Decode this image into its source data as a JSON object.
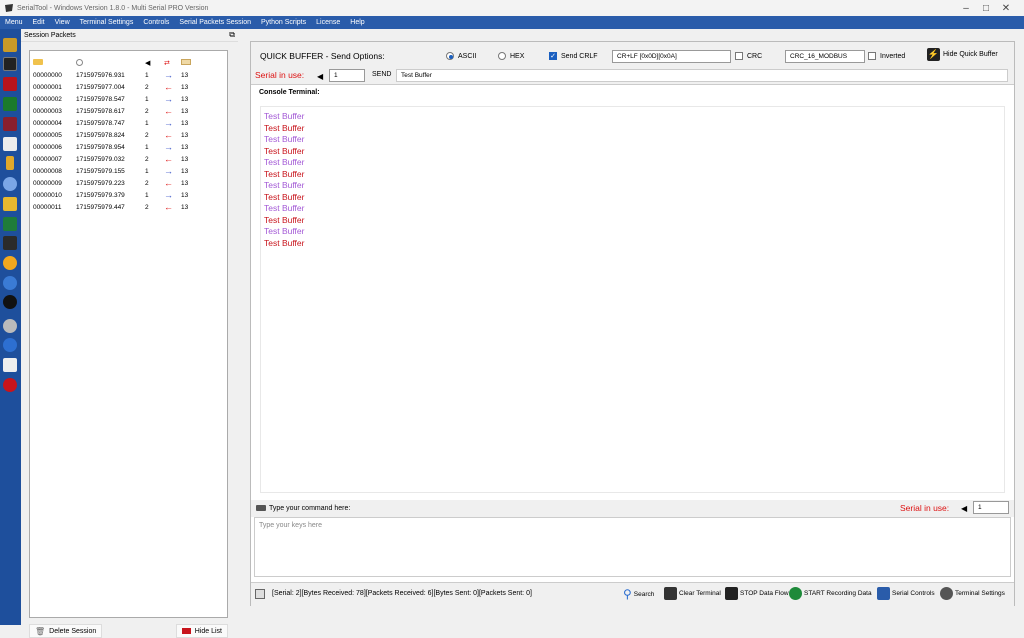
{
  "window": {
    "title": "SerialTool - Windows Version 1.8.0 - Multi Serial PRO Version"
  },
  "menu": [
    "Menu",
    "Edit",
    "View",
    "Terminal Settings",
    "Controls",
    "Serial Packets Session",
    "Python Scripts",
    "License",
    "Help"
  ],
  "sidebar": {
    "title": "Session Packets"
  },
  "packets": [
    {
      "id": "00000000",
      "ts": "1715975976.931",
      "port": "1",
      "dir": "out",
      "len": "13"
    },
    {
      "id": "00000001",
      "ts": "1715975977.004",
      "port": "2",
      "dir": "in",
      "len": "13"
    },
    {
      "id": "00000002",
      "ts": "1715975978.547",
      "port": "1",
      "dir": "out",
      "len": "13"
    },
    {
      "id": "00000003",
      "ts": "1715975978.617",
      "port": "2",
      "dir": "in",
      "len": "13"
    },
    {
      "id": "00000004",
      "ts": "1715975978.747",
      "port": "1",
      "dir": "out",
      "len": "13"
    },
    {
      "id": "00000005",
      "ts": "1715975978.824",
      "port": "2",
      "dir": "in",
      "len": "13"
    },
    {
      "id": "00000006",
      "ts": "1715975978.954",
      "port": "1",
      "dir": "out",
      "len": "13"
    },
    {
      "id": "00000007",
      "ts": "1715975979.032",
      "port": "2",
      "dir": "in",
      "len": "13"
    },
    {
      "id": "00000008",
      "ts": "1715975979.155",
      "port": "1",
      "dir": "out",
      "len": "13"
    },
    {
      "id": "00000009",
      "ts": "1715975979.223",
      "port": "2",
      "dir": "in",
      "len": "13"
    },
    {
      "id": "00000010",
      "ts": "1715975979.379",
      "port": "1",
      "dir": "out",
      "len": "13"
    },
    {
      "id": "00000011",
      "ts": "1715975979.447",
      "port": "2",
      "dir": "in",
      "len": "13"
    }
  ],
  "session_footer": {
    "delete_label": "Delete Session",
    "hide_label": "Hide List"
  },
  "quick_buffer": {
    "title": "QUICK BUFFER - Send Options:",
    "ascii_label": "ASCII",
    "hex_label": "HEX",
    "send_crlf_label": "Send CRLF",
    "crlf_value": "CR+LF [0x0D][0x0A]",
    "crc_label": "CRC",
    "crc_value": "CRC_16_MODBUS",
    "inverted_label": "Inverted",
    "hide_label": "Hide Quick Buffer",
    "serial_in_use_label": "Serial in use:",
    "serial_value": "1",
    "send_label": "SEND",
    "buffer_value": "Test Buffer"
  },
  "console": {
    "label": "Console Terminal:",
    "lines": [
      {
        "text": "Test Buffer",
        "type": "tx"
      },
      {
        "text": "Test Buffer",
        "type": "rx"
      },
      {
        "text": "Test Buffer",
        "type": "tx"
      },
      {
        "text": "Test Buffer",
        "type": "rx"
      },
      {
        "text": "Test Buffer",
        "type": "tx"
      },
      {
        "text": "Test Buffer",
        "type": "rx"
      },
      {
        "text": "Test Buffer",
        "type": "tx"
      },
      {
        "text": "Test Buffer",
        "type": "rx"
      },
      {
        "text": "Test Buffer",
        "type": "tx"
      },
      {
        "text": "Test Buffer",
        "type": "rx"
      },
      {
        "text": "Test Buffer",
        "type": "tx"
      },
      {
        "text": "Test Buffer",
        "type": "rx"
      }
    ]
  },
  "command": {
    "label": "Type your command here:",
    "serial_in_use_label": "Serial in use:",
    "serial_value": "1",
    "placeholder": "Type your keys here"
  },
  "status": {
    "text": "[Serial: 2][Bytes Received: 78][Packets Received: 6][Bytes Sent: 0][Packets Sent: 0]",
    "search": "Search",
    "clear": "Clear Terminal",
    "stop": "STOP Data Flow",
    "record": "START Recording Data",
    "serial_controls": "Serial Controls",
    "terminal_settings": "Terminal Settings"
  },
  "colors": {
    "menubar": "#2a5caa",
    "leftbar": "#1e4f9c",
    "tx": "#a359d6",
    "rx": "#c8141c",
    "serial_label": "#d11111"
  }
}
